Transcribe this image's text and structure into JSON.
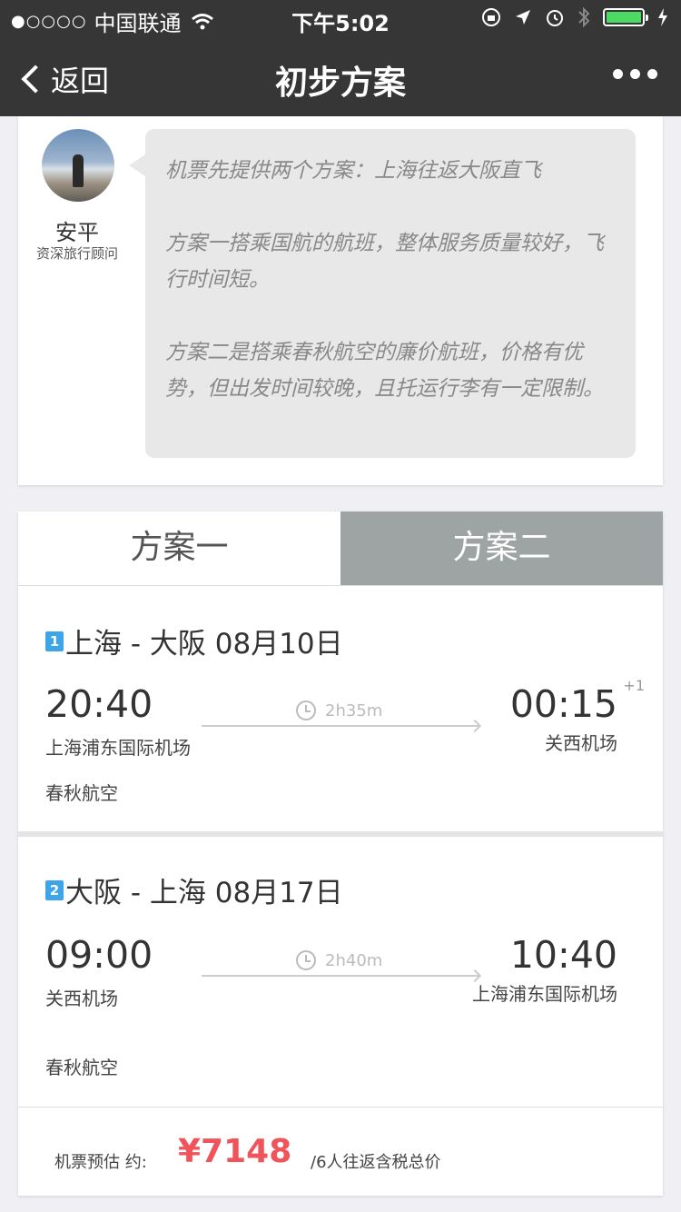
{
  "status_bar": {
    "signal": "●○○○○",
    "carrier": "中国联通",
    "time": "下午5:02",
    "battery_level": 1.0
  },
  "nav": {
    "back_label": "返回",
    "title": "初步方案"
  },
  "advisor": {
    "name": "安平",
    "title": "资深旅行顾问",
    "message": [
      "机票先提供两个方案：上海往返大阪直飞",
      "方案一搭乘国航的航班，整体服务质量较好，飞行时间短。",
      "方案二是搭乘春秋航空的廉价航班，价格有优势，但出发时间较晚，且托运行李有一定限制。"
    ]
  },
  "tabs": [
    {
      "label": "方案一",
      "active": true
    },
    {
      "label": "方案二",
      "active": false
    }
  ],
  "segments": [
    {
      "index": "1",
      "route": "上海 - 大阪 08月10日",
      "dep_time": "20:40",
      "arr_time": "00:15",
      "next_day": "+1",
      "duration": "2h35m",
      "dep_airport": "上海浦东国际机场",
      "arr_airport": "关西机场",
      "airline": "春秋航空"
    },
    {
      "index": "2",
      "route": "大阪 - 上海 08月17日",
      "dep_time": "09:00",
      "arr_time": "10:40",
      "duration": "2h40m",
      "dep_airport": "关西机场",
      "arr_airport": "上海浦东国际机场",
      "airline": "春秋航空"
    }
  ],
  "price": {
    "label": "机票预估 约:",
    "amount": "¥7148",
    "note": "/6人往返含税总价"
  },
  "colors": {
    "bar": "#363636",
    "price": "#f0545a",
    "badge": "#3ea6e8",
    "tab_inactive": "#9ea3a3",
    "battery": "#4cd964"
  }
}
